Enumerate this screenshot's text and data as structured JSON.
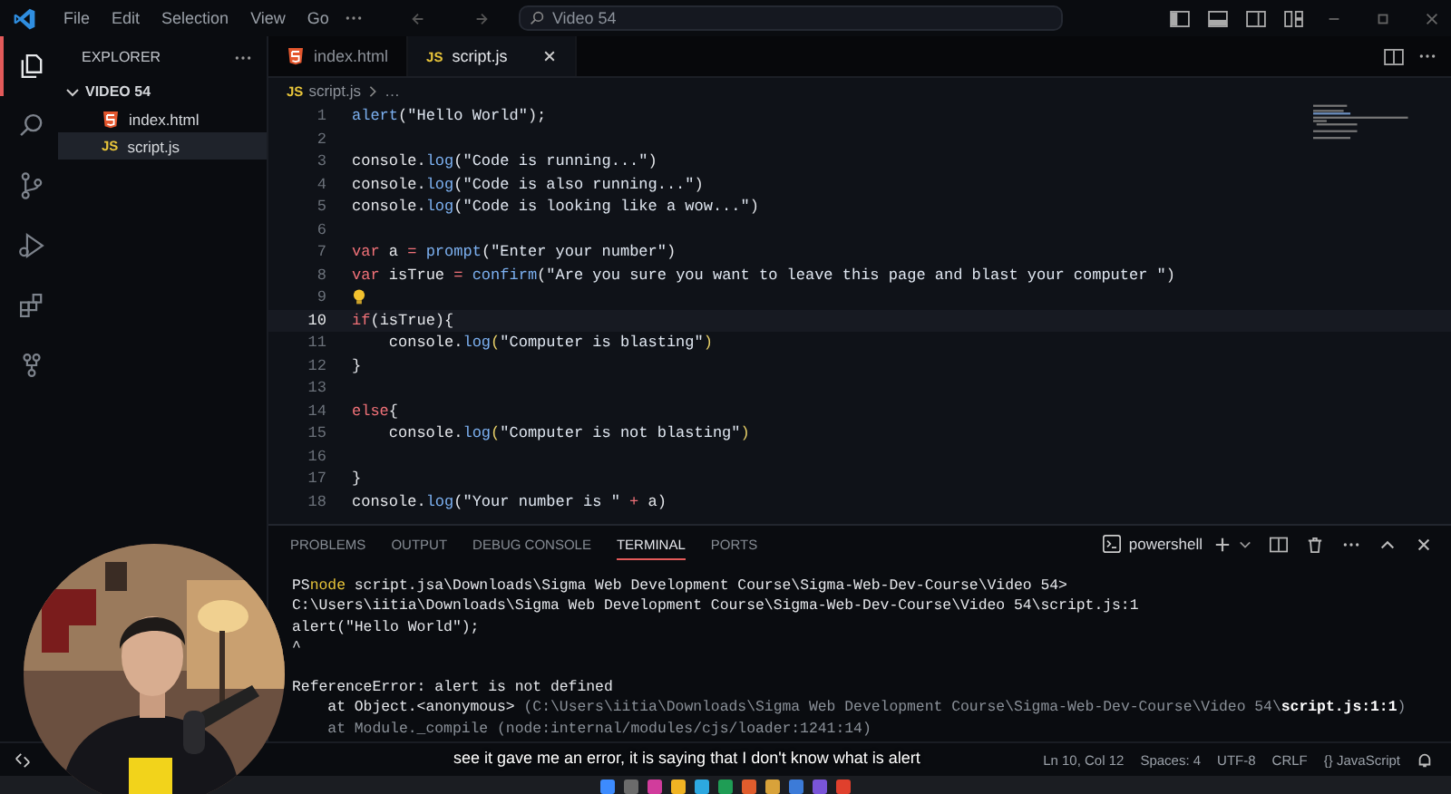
{
  "menu": [
    "File",
    "Edit",
    "Selection",
    "View",
    "Go"
  ],
  "search": {
    "value": "Video 54"
  },
  "activity": [
    {
      "kind": "files",
      "selected": true
    },
    {
      "kind": "search",
      "selected": false
    },
    {
      "kind": "source",
      "selected": false
    },
    {
      "kind": "debug",
      "selected": false
    },
    {
      "kind": "extensions",
      "selected": false
    },
    {
      "kind": "graph",
      "selected": false
    }
  ],
  "explorer": {
    "title": "EXPLORER",
    "folder": {
      "label": "VIDEO 54",
      "expanded": true,
      "children": [
        {
          "label": "index.html",
          "kind": "html",
          "selected": false
        },
        {
          "label": "script.js",
          "kind": "js",
          "badge": "JS",
          "selected": true
        }
      ]
    }
  },
  "tabs": [
    {
      "label": "index.html",
      "kind": "html",
      "selected": false
    },
    {
      "label": "script.js",
      "kind": "js",
      "badge": "JS",
      "selected": true
    }
  ],
  "breadcrumb": {
    "badge": "JS",
    "file": "script.js",
    "rest": "…"
  },
  "code": [
    {
      "n": "1",
      "active": false,
      "lightbulb": false,
      "tokens": [
        {
          "text": "alert",
          "kind": "fn"
        },
        {
          "text": "(",
          "kind": "br"
        },
        {
          "text": "\"Hello World\"",
          "kind": "str"
        },
        {
          "text": ");",
          "kind": "br"
        }
      ]
    },
    {
      "n": "2",
      "active": false,
      "lightbulb": false
    },
    {
      "n": "3",
      "active": false,
      "lightbulb": false,
      "tokens": [
        {
          "text": "console.",
          "kind": "id"
        },
        {
          "text": "log",
          "kind": "fn"
        },
        {
          "text": "(",
          "kind": "br"
        },
        {
          "text": "\"Code is running...\"",
          "kind": "str"
        },
        {
          "text": ")",
          "kind": "br"
        }
      ]
    },
    {
      "n": "4",
      "active": false,
      "lightbulb": false,
      "tokens": [
        {
          "text": "console.",
          "kind": "id"
        },
        {
          "text": "log",
          "kind": "fn"
        },
        {
          "text": "(",
          "kind": "br"
        },
        {
          "text": "\"Code is also running...\"",
          "kind": "str"
        },
        {
          "text": ")",
          "kind": "br"
        }
      ]
    },
    {
      "n": "5",
      "active": false,
      "lightbulb": false,
      "tokens": [
        {
          "text": "console.",
          "kind": "id"
        },
        {
          "text": "log",
          "kind": "fn"
        },
        {
          "text": "(",
          "kind": "br"
        },
        {
          "text": "\"Code is looking like a wow...\"",
          "kind": "str"
        },
        {
          "text": ")",
          "kind": "br"
        }
      ]
    },
    {
      "n": "6",
      "active": false,
      "lightbulb": false
    },
    {
      "n": "7",
      "active": false,
      "lightbulb": false,
      "tokens": [
        {
          "text": "var",
          "kind": "kw"
        },
        {
          "text": " a ",
          "kind": "id"
        },
        {
          "text": "=",
          "kind": "kw"
        },
        {
          "text": " prompt",
          "kind": "fn"
        },
        {
          "text": "(",
          "kind": "br"
        },
        {
          "text": "\"Enter your number\"",
          "kind": "str"
        },
        {
          "text": ")",
          "kind": "br"
        }
      ]
    },
    {
      "n": "8",
      "active": false,
      "lightbulb": false,
      "tokens": [
        {
          "text": "var",
          "kind": "kw"
        },
        {
          "text": " isTrue ",
          "kind": "id"
        },
        {
          "text": "=",
          "kind": "kw"
        },
        {
          "text": " confirm",
          "kind": "fn"
        },
        {
          "text": "(",
          "kind": "br"
        },
        {
          "text": "\"Are you sure you want to leave this page and blast your computer \"",
          "kind": "str"
        },
        {
          "text": ")",
          "kind": "br"
        }
      ]
    },
    {
      "n": "9",
      "active": false,
      "lightbulb": true
    },
    {
      "n": "10",
      "active": true,
      "lightbulb": false,
      "tokens": [
        {
          "text": "if",
          "kind": "kw"
        },
        {
          "text": "(",
          "kind": "br"
        },
        {
          "text": "isTrue",
          "kind": "id"
        },
        {
          "text": "){",
          "kind": "br"
        }
      ]
    },
    {
      "n": "11",
      "active": false,
      "lightbulb": false,
      "tokens": [
        {
          "text": "    console.",
          "kind": "id"
        },
        {
          "text": "log",
          "kind": "fn"
        },
        {
          "text": "(",
          "kind": "br2"
        },
        {
          "text": "\"Computer is blasting\"",
          "kind": "str"
        },
        {
          "text": ")",
          "kind": "br2"
        }
      ]
    },
    {
      "n": "12",
      "active": false,
      "lightbulb": false,
      "tokens": [
        {
          "text": "}",
          "kind": "br"
        }
      ]
    },
    {
      "n": "13",
      "active": false,
      "lightbulb": false
    },
    {
      "n": "14",
      "active": false,
      "lightbulb": false,
      "tokens": [
        {
          "text": "else",
          "kind": "kw"
        },
        {
          "text": "{",
          "kind": "br"
        }
      ]
    },
    {
      "n": "15",
      "active": false,
      "lightbulb": false,
      "tokens": [
        {
          "text": "    console.",
          "kind": "id"
        },
        {
          "text": "log",
          "kind": "fn"
        },
        {
          "text": "(",
          "kind": "br2"
        },
        {
          "text": "\"Computer is not blasting\"",
          "kind": "str"
        },
        {
          "text": ")",
          "kind": "br2"
        }
      ]
    },
    {
      "n": "16",
      "active": false,
      "lightbulb": false
    },
    {
      "n": "17",
      "active": false,
      "lightbulb": false,
      "tokens": [
        {
          "text": "}",
          "kind": "br"
        }
      ]
    },
    {
      "n": "18",
      "active": false,
      "lightbulb": false,
      "tokens": [
        {
          "text": "console.",
          "kind": "id"
        },
        {
          "text": "log",
          "kind": "fn"
        },
        {
          "text": "(",
          "kind": "br"
        },
        {
          "text": "\"Your number is \"",
          "kind": "str"
        },
        {
          "text": " + ",
          "kind": "kw"
        },
        {
          "text": "a",
          "kind": "id"
        },
        {
          "text": ")",
          "kind": "br"
        }
      ]
    }
  ],
  "panel": {
    "tabs": [
      {
        "label": "PROBLEMS",
        "selected": false
      },
      {
        "label": "OUTPUT",
        "selected": false
      },
      {
        "label": "DEBUG CONSOLE",
        "selected": false
      },
      {
        "label": "TERMINAL",
        "selected": true
      },
      {
        "label": "PORTS",
        "selected": false
      }
    ],
    "shell": "powershell",
    "terminal": [
      [
        [
          {
            "text": "PS",
            "kind": "plain"
          },
          {
            "text": "node",
            "kind": "cmd"
          },
          {
            "text": " script.jsa\\Downloads\\Sigma Web Development Course\\Sigma-Web-Dev-Course\\Video 54>",
            "kind": "plain"
          }
        ],
        [
          {
            "text": "C:\\Users\\iitia\\Downloads\\Sigma Web Development Course\\Sigma-Web-Dev-Course\\Video 54\\script.js:1",
            "kind": "plain"
          }
        ],
        [
          {
            "text": "alert(\"Hello World\");",
            "kind": "plain"
          }
        ],
        [
          {
            "text": "^",
            "kind": "plain"
          }
        ]
      ],
      [
        [
          {
            "text": "ReferenceError: alert is not defined",
            "kind": "plain"
          }
        ],
        [
          {
            "text": "    at Object.<anonymous> ",
            "kind": "plain"
          },
          {
            "text": "(C:\\Users\\iitia\\Downloads\\Sigma Web Development Course\\Sigma-Web-Dev-Course\\Video 54\\",
            "kind": "dim"
          },
          {
            "text": "script.js:1:1",
            "kind": "bold"
          },
          {
            "text": ")",
            "kind": "dim"
          }
        ],
        [
          {
            "text": "    at Module._compile (node:internal/modules/cjs/loader:1241:14)",
            "kind": "dim"
          }
        ]
      ]
    ]
  },
  "status": [
    "Ln 10, Col 12",
    "Spaces: 4",
    "UTF-8",
    "CRLF",
    "{} JavaScript"
  ],
  "caption": "see it gave me an error, it is saying that I don't know what is alert",
  "webcam": {
    "kind": "picture"
  }
}
